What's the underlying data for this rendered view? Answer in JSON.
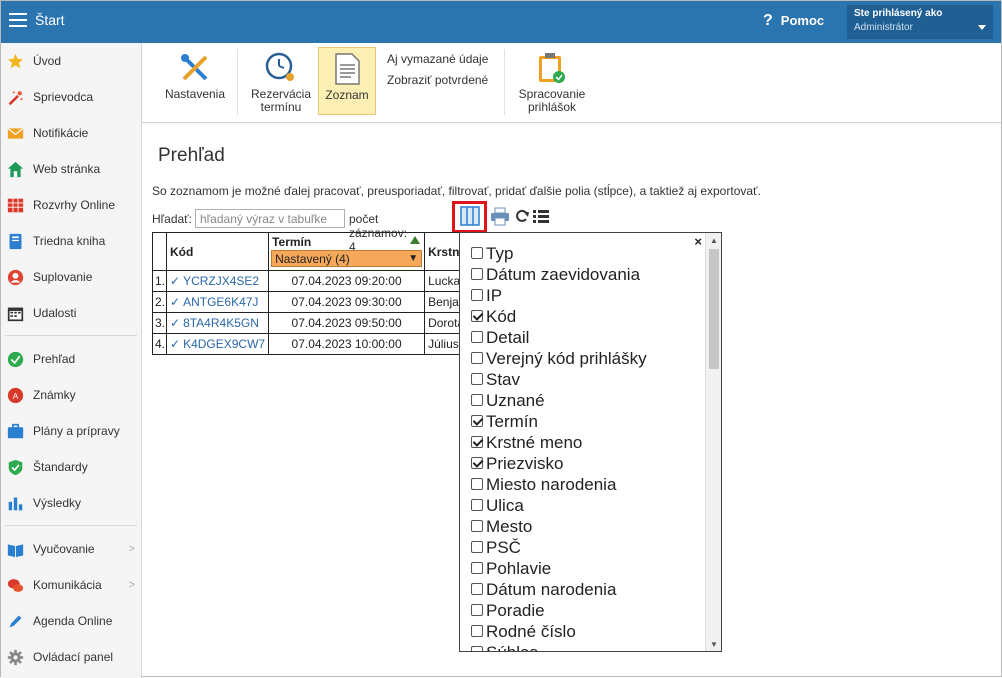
{
  "header": {
    "app_title": "Štart",
    "help_label": "Pomoc",
    "user_line1": "Ste prihlásený ako",
    "user_line2": "Administrátor"
  },
  "sidebar": {
    "items": [
      {
        "label": "Úvod",
        "icon": "star-icon"
      },
      {
        "label": "Sprievodca",
        "icon": "magic-wand-icon"
      },
      {
        "label": "Notifikácie",
        "icon": "envelope-icon"
      },
      {
        "label": "Web stránka",
        "icon": "house-icon"
      },
      {
        "label": "Rozvrhy Online",
        "icon": "grid-calendar-icon"
      },
      {
        "label": "Triedna kniha",
        "icon": "book-icon"
      },
      {
        "label": "Suplovanie",
        "icon": "person-icon"
      },
      {
        "label": "Udalosti",
        "icon": "calendar-icon"
      },
      {
        "label": "Prehľad",
        "icon": "check-circle-icon"
      },
      {
        "label": "Známky",
        "icon": "grade-icon"
      },
      {
        "label": "Plány a prípravy",
        "icon": "briefcase-icon"
      },
      {
        "label": "Štandardy",
        "icon": "shield-check-icon"
      },
      {
        "label": "Výsledky",
        "icon": "bar-chart-icon"
      },
      {
        "label": "Vyučovanie",
        "icon": "open-book-icon"
      },
      {
        "label": "Komunikácia",
        "icon": "chat-icon"
      },
      {
        "label": "Agenda Online",
        "icon": "pen-icon"
      },
      {
        "label": "Ovládací panel",
        "icon": "gear-icon"
      }
    ]
  },
  "ribbon": {
    "settings": "Nastavenia",
    "reservation_line1": "Rezervácia",
    "reservation_line2": "termínu",
    "list": "Zoznam",
    "show_deleted": "Aj vymazané údaje",
    "show_confirmed": "Zobraziť potvrdené",
    "processing_line1": "Spracovanie",
    "processing_line2": "prihlášok"
  },
  "main": {
    "title": "Prehľad",
    "description": "So zoznamom je možné ďalej pracovať, preusporiadať, filtrovať, pridať ďalšie polia (stĺpce), a taktiež aj exportovať.",
    "search_label": "Hľadať:",
    "search_placeholder": "hľadaný výraz v tabuľke",
    "count_label": "počet záznamov: 4"
  },
  "table": {
    "col_kod": "Kód",
    "col_termin": "Termín",
    "termin_filter": "Nastavený (4)",
    "col_krstne": "Krstné",
    "rows": [
      {
        "n": "1.",
        "kod": "YCRZJX4SE2",
        "termin": "07.04.2023 09:20:00",
        "meno": "Lucka"
      },
      {
        "n": "2.",
        "kod": "ANTGE6K47J",
        "termin": "07.04.2023 09:30:00",
        "meno": "Benjan"
      },
      {
        "n": "3.",
        "kod": "8TA4R4K5GN",
        "termin": "07.04.2023 09:50:00",
        "meno": "Dorota"
      },
      {
        "n": "4.",
        "kod": "K4DGEX9CW7",
        "termin": "07.04.2023 10:00:00",
        "meno": "Július"
      }
    ]
  },
  "columns_popup": {
    "close": "×",
    "options": [
      {
        "label": "Typ",
        "checked": false
      },
      {
        "label": "Dátum zaevidovania",
        "checked": false
      },
      {
        "label": "IP",
        "checked": false
      },
      {
        "label": "Kód",
        "checked": true
      },
      {
        "label": "Detail",
        "checked": false
      },
      {
        "label": "Verejný kód prihlášky",
        "checked": false
      },
      {
        "label": "Stav",
        "checked": false
      },
      {
        "label": "Uznané",
        "checked": false
      },
      {
        "label": "Termín",
        "checked": true
      },
      {
        "label": "Krstné meno",
        "checked": true
      },
      {
        "label": "Priezvisko",
        "checked": true
      },
      {
        "label": "Miesto narodenia",
        "checked": false
      },
      {
        "label": "Ulica",
        "checked": false
      },
      {
        "label": "Mesto",
        "checked": false
      },
      {
        "label": "PSČ",
        "checked": false
      },
      {
        "label": "Pohlavie",
        "checked": false
      },
      {
        "label": "Dátum narodenia",
        "checked": false
      },
      {
        "label": "Poradie",
        "checked": false
      },
      {
        "label": "Rodné číslo",
        "checked": false
      },
      {
        "label": "Súhlas",
        "checked": false
      }
    ]
  },
  "colors": {
    "topbar": "#2a74b0",
    "highlight": "#e0141b",
    "filter": "#f5a85a",
    "link": "#2a67a8"
  }
}
